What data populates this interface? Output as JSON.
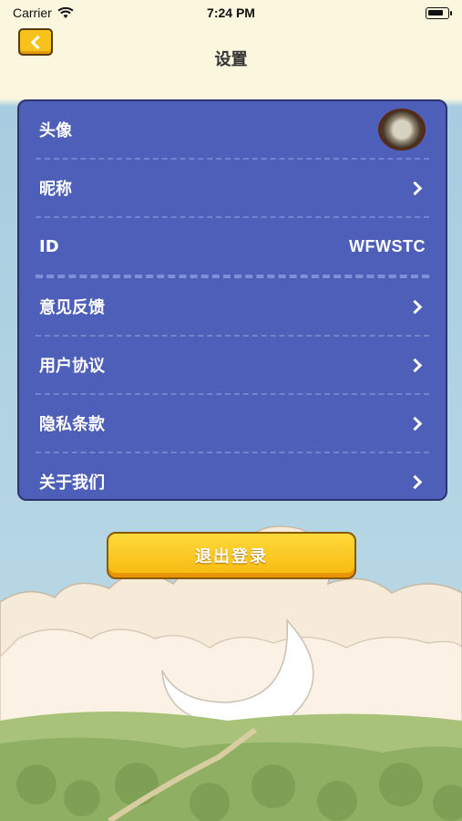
{
  "status_bar": {
    "carrier": "Carrier",
    "time": "7:24 PM"
  },
  "nav": {
    "title": "设置"
  },
  "settings": {
    "rows": [
      {
        "label": "头像",
        "type": "avatar"
      },
      {
        "label": "昵称",
        "type": "arrow"
      },
      {
        "label": "ID",
        "type": "value",
        "value": "WFWSTC"
      },
      {
        "label": "意见反馈",
        "type": "arrow"
      },
      {
        "label": "用户协议",
        "type": "arrow"
      },
      {
        "label": "隐私条款",
        "type": "arrow"
      },
      {
        "label": "关于我们",
        "type": "arrow"
      }
    ]
  },
  "logout": {
    "label": "退出登录"
  },
  "colors": {
    "panel": "#4d5fb8",
    "button": "#f7c21c",
    "sky": "#a9cfe0"
  }
}
